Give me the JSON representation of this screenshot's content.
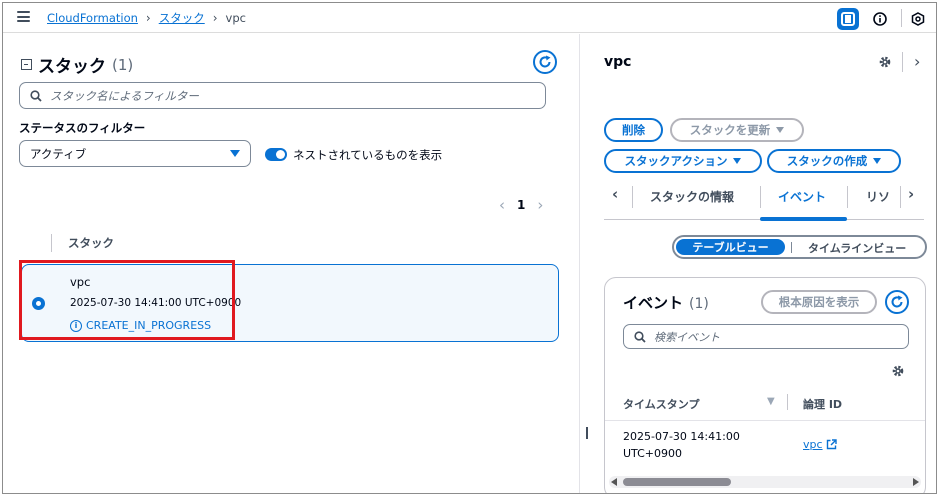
{
  "breadcrumb": {
    "items": [
      "CloudFormation",
      "スタック"
    ],
    "current": "vpc"
  },
  "left_panel": {
    "title": "スタック",
    "count": "(1)",
    "search": {
      "placeholder": "スタック名によるフィルター"
    },
    "status_filter": {
      "label": "ステータスのフィルター",
      "selected": "アクティブ"
    },
    "nested_toggle": {
      "label": "ネストされているものを表示",
      "on": true
    },
    "pagination": {
      "page": "1"
    },
    "table": {
      "column": "スタック",
      "rows": [
        {
          "name": "vpc",
          "created": "2025-07-30 14:41:00 UTC+0900",
          "status": "CREATE_IN_PROGRESS",
          "selected": true
        }
      ]
    }
  },
  "right_panel": {
    "title": "vpc",
    "actions": {
      "delete": "削除",
      "update": "スタックを更新",
      "stack_actions": "スタックアクション",
      "create": "スタックの作成"
    },
    "tabs": [
      "スタックの情報",
      "イベント",
      "リソ"
    ],
    "active_tab": "イベント",
    "view_toggle": {
      "table": "テーブルビュー",
      "timeline": "タイムラインビュー"
    },
    "events": {
      "title": "イベント",
      "count": "(1)",
      "root_cause_button": "根本原因を表示",
      "search_placeholder": "検索イベント",
      "columns": {
        "timestamp": "タイムスタンプ",
        "logical_id": "論理 ID"
      },
      "rows": [
        {
          "timestamp_line1": "2025-07-30 14:41:00",
          "timestamp_line2": "UTC+0900",
          "logical_id": "vpc"
        }
      ]
    }
  },
  "colors": {
    "accent": "#0972d3",
    "highlight": "#e0191f",
    "selected_row_bg": "#f2f8fd"
  }
}
